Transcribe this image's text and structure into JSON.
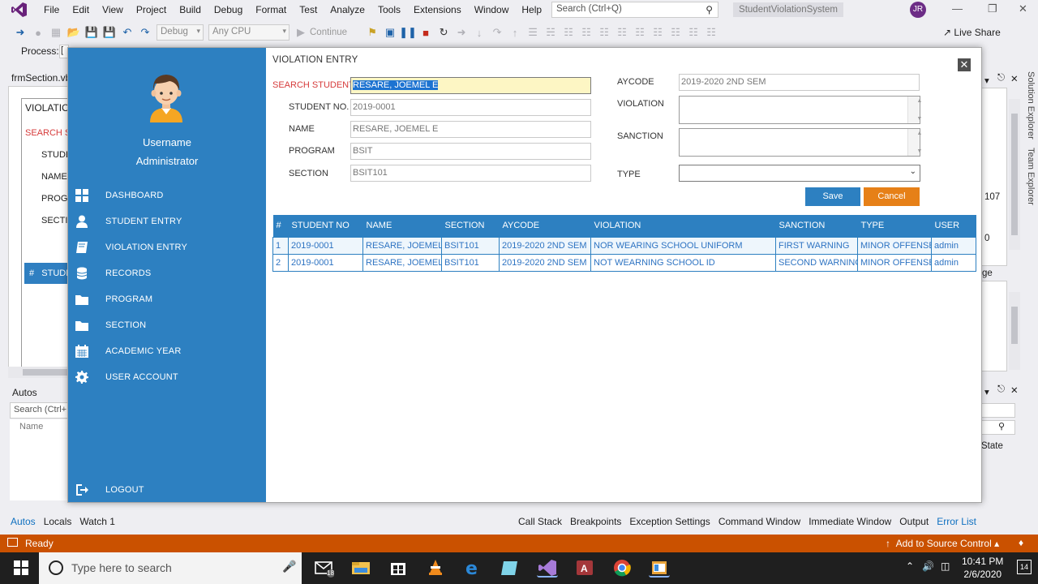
{
  "vs": {
    "menu": [
      "File",
      "Edit",
      "View",
      "Project",
      "Build",
      "Debug",
      "Format",
      "Test",
      "Analyze",
      "Tools",
      "Extensions",
      "Window",
      "Help"
    ],
    "search_placeholder": "Search (Ctrl+Q)",
    "solution_name": "StudentViolationSystem",
    "user_initials": "JR",
    "config": "Debug",
    "platform": "Any CPU",
    "continue_label": "Continue",
    "live_share": "Live Share",
    "process_label": "Process:",
    "process_value": "[",
    "doc_tab": "frmSection.vb",
    "designer": {
      "title": "VIOLATION",
      "search": "SEARCH ST",
      "fields": [
        "STUDE",
        "NAME",
        "PROGR",
        "SECTIO"
      ],
      "row_hash": "#",
      "row_text": "STUDE"
    },
    "autos": {
      "title": "Autos",
      "search": "Search (Ctrl+E)",
      "col_name": "Name"
    },
    "bottom_tabs_left": [
      "Autos",
      "Locals",
      "Watch 1"
    ],
    "bottom_tabs_right": [
      "Call Stack",
      "Breakpoints",
      "Exception Settings",
      "Command Window",
      "Immediate Window",
      "Output",
      "Error List"
    ],
    "right_panel": {
      "val_107": "107",
      "val_0": "0",
      "ge": "ge",
      "state": "State",
      "solution_explorer": "Solution Explorer",
      "team_explorer": "Team Explorer"
    },
    "status": {
      "ready": "Ready",
      "source_control": "Add to Source Control"
    }
  },
  "taskbar": {
    "search_placeholder": "Type here to search",
    "mail_badge": "18",
    "time": "10:41 PM",
    "date": "2/6/2020",
    "notifications": "14"
  },
  "app": {
    "sidebar": {
      "username": "Username",
      "role": "Administrator",
      "nav": [
        {
          "label": "DASHBOARD",
          "icon": "dashboard-icon"
        },
        {
          "label": "STUDENT ENTRY",
          "icon": "user-icon"
        },
        {
          "label": "VIOLATION ENTRY",
          "icon": "book-icon"
        },
        {
          "label": "RECORDS",
          "icon": "database-icon"
        },
        {
          "label": "PROGRAM",
          "icon": "folder-icon"
        },
        {
          "label": "SECTION",
          "icon": "folder-icon"
        },
        {
          "label": "ACADEMIC YEAR",
          "icon": "calendar-icon"
        },
        {
          "label": "USER ACCOUNT",
          "icon": "gear-icon"
        }
      ],
      "logout": "LOGOUT"
    },
    "form": {
      "title": "VIOLATION ENTRY",
      "close": "✕",
      "search_label": "SEARCH STUDENT",
      "search_value": "RESARE, JOEMEL E",
      "student_no_label": "STUDENT NO.",
      "student_no": "2019-0001",
      "name_label": "NAME",
      "name": "RESARE, JOEMEL E",
      "program_label": "PROGRAM",
      "program": "BSIT",
      "section_label": "SECTION",
      "section": "BSIT101",
      "aycode_label": "AYCODE",
      "aycode": "2019-2020 2ND SEM",
      "violation_label": "VIOLATION",
      "sanction_label": "SANCTION",
      "type_label": "TYPE",
      "type_value": "",
      "save": "Save",
      "cancel": "Cancel"
    },
    "grid": {
      "columns": [
        "#",
        "STUDENT NO",
        "NAME",
        "SECTION",
        "AYCODE",
        "VIOLATION",
        "SANCTION",
        "TYPE",
        "USER"
      ],
      "rows": [
        [
          "1",
          "2019-0001",
          "RESARE, JOEMEL E",
          "BSIT101",
          "2019-2020 2ND SEM",
          "NOR WEARING SCHOOL UNIFORM",
          "FIRST WARNING",
          "MINOR OFFENSE",
          "admin"
        ],
        [
          "2",
          "2019-0001",
          "RESARE, JOEMEL E",
          "BSIT101",
          "2019-2020 2ND SEM",
          "NOT WEARNING SCHOOL ID",
          "SECOND WARNING",
          "MINOR OFFENSE",
          "admin"
        ]
      ]
    }
  },
  "colors": {
    "sidebar": "#2d80c1",
    "cancel": "#e68018",
    "status_bar": "#ca5100",
    "label_red": "#d63b3b"
  }
}
